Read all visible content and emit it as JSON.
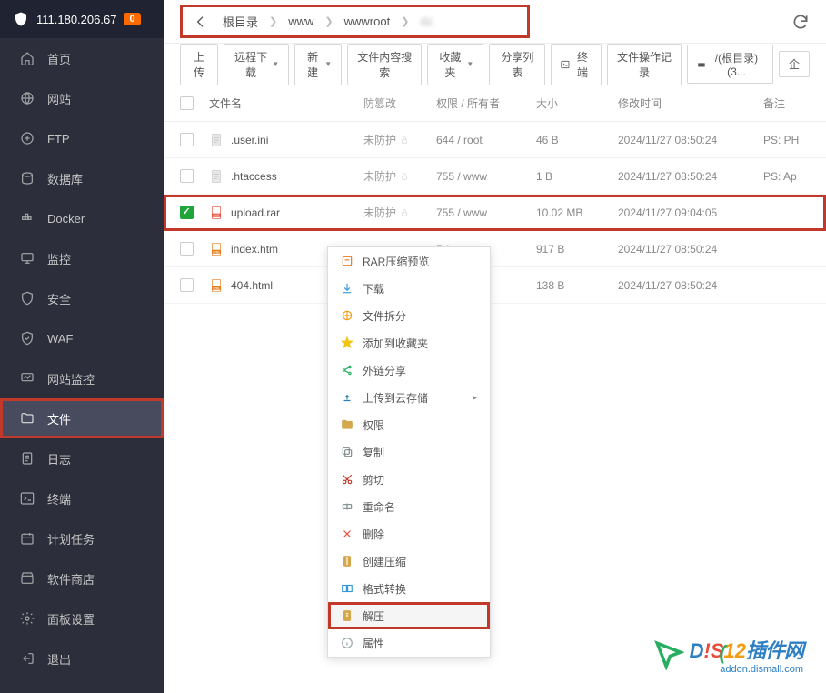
{
  "header": {
    "ip": "111.180.206.67",
    "badge": "0"
  },
  "sidebar": {
    "items": [
      {
        "label": "首页",
        "icon": "home"
      },
      {
        "label": "网站",
        "icon": "globe"
      },
      {
        "label": "FTP",
        "icon": "ftp"
      },
      {
        "label": "数据库",
        "icon": "database"
      },
      {
        "label": "Docker",
        "icon": "docker"
      },
      {
        "label": "监控",
        "icon": "monitor"
      },
      {
        "label": "安全",
        "icon": "security"
      },
      {
        "label": "WAF",
        "icon": "waf"
      },
      {
        "label": "网站监控",
        "icon": "site-monitor"
      },
      {
        "label": "文件",
        "icon": "folder",
        "active": true,
        "highlight": true
      },
      {
        "label": "日志",
        "icon": "log"
      },
      {
        "label": "终端",
        "icon": "terminal"
      },
      {
        "label": "计划任务",
        "icon": "cron"
      },
      {
        "label": "软件商店",
        "icon": "store"
      },
      {
        "label": "面板设置",
        "icon": "settings"
      },
      {
        "label": "退出",
        "icon": "logout"
      }
    ]
  },
  "breadcrumb": {
    "items": [
      "根目录",
      "www",
      "wwwroot",
      "dz."
    ]
  },
  "toolbar": {
    "upload": "上传",
    "remote_download": "远程下载",
    "new": "新建",
    "content_search": "文件内容搜索",
    "favorites": "收藏夹",
    "share_list": "分享列表",
    "terminal": "终端",
    "file_ops": "文件操作记录",
    "disk": "/(根目录) (3...",
    "enterprise": "企"
  },
  "table": {
    "headers": {
      "name": "文件名",
      "tamper": "防篡改",
      "perm": "权限 / 所有者",
      "size": "大小",
      "time": "修改时间",
      "note": "备注"
    },
    "rows": [
      {
        "name": ".user.ini",
        "icon": "generic",
        "tamper": "未防护",
        "perm": "644 / root",
        "size": "46 B",
        "time": "2024/11/27 08:50:24",
        "note": "PS: PH",
        "checked": false
      },
      {
        "name": ".htaccess",
        "icon": "generic",
        "tamper": "未防护",
        "perm": "755 / www",
        "size": "1 B",
        "time": "2024/11/27 08:50:24",
        "note": "PS: Ap",
        "checked": false
      },
      {
        "name": "upload.rar",
        "icon": "rar",
        "tamper": "未防护",
        "perm": "755 / www",
        "size": "10.02 MB",
        "time": "2024/11/27 09:04:05",
        "note": "",
        "checked": true,
        "highlight": true
      },
      {
        "name": "index.htm",
        "icon": "html",
        "tamper": "",
        "perm": "5 / www",
        "size": "917 B",
        "time": "2024/11/27 08:50:24",
        "note": "",
        "checked": false
      },
      {
        "name": "404.html",
        "icon": "html",
        "tamper": "",
        "perm": "5 / www",
        "size": "138 B",
        "time": "2024/11/27 08:50:24",
        "note": "",
        "checked": false
      }
    ]
  },
  "context_menu": {
    "items": [
      {
        "label": "RAR压缩预览",
        "icon": "rar-preview",
        "color": "#e67e22"
      },
      {
        "label": "下载",
        "icon": "download",
        "color": "#3498db"
      },
      {
        "label": "文件拆分",
        "icon": "split",
        "color": "#f39c12"
      },
      {
        "label": "添加到收藏夹",
        "icon": "star",
        "color": "#f1c40f"
      },
      {
        "label": "外链分享",
        "icon": "share",
        "color": "#27ae60"
      },
      {
        "label": "上传到云存储",
        "icon": "cloud-upload",
        "color": "#2980b9",
        "has_sub": true
      },
      {
        "label": "权限",
        "icon": "folder-perm",
        "color": "#d4a84b"
      },
      {
        "label": "复制",
        "icon": "copy",
        "color": "#7f8c8d"
      },
      {
        "label": "剪切",
        "icon": "cut",
        "color": "#c0392b"
      },
      {
        "label": "重命名",
        "icon": "rename",
        "color": "#7f8c8d"
      },
      {
        "label": "删除",
        "icon": "delete",
        "color": "#e74c3c"
      },
      {
        "label": "创建压缩",
        "icon": "compress",
        "color": "#d4a84b"
      },
      {
        "label": "格式转换",
        "icon": "convert",
        "color": "#3498db"
      },
      {
        "label": "解压",
        "icon": "extract",
        "color": "#d4a84b",
        "highlight": true
      },
      {
        "label": "属性",
        "icon": "info",
        "color": "#95a5a6"
      }
    ]
  },
  "watermark": {
    "brand1": "D",
    "brand2": "!S",
    "brand3": "12",
    "brand4": "插件网",
    "sub": "addon.dismall.com"
  }
}
